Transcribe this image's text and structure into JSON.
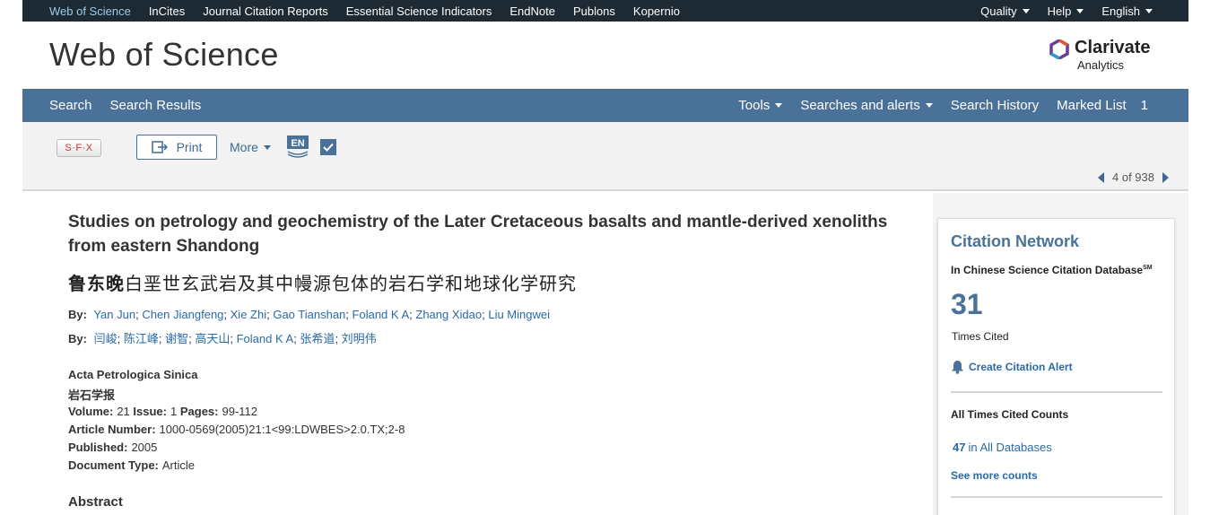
{
  "topbar": {
    "links": [
      "Web of Science",
      "InCites",
      "Journal Citation Reports",
      "Essential Science Indicators",
      "EndNote",
      "Publons",
      "Kopernio"
    ],
    "right": [
      "Quality",
      "Help",
      "English"
    ]
  },
  "brand": {
    "title": "Web of Science",
    "logo_word": "Clarivate",
    "logo_sub": "Analytics"
  },
  "nav": {
    "left": [
      "Search",
      "Search Results"
    ],
    "tools": "Tools",
    "alerts": "Searches and alerts",
    "history": "Search History",
    "marked": "Marked List",
    "marked_count": "1"
  },
  "toolbar": {
    "sfx": "S·F·X",
    "print": "Print",
    "more": "More",
    "en": "EN",
    "pager": "4 of 938"
  },
  "record": {
    "title": "Studies on petrology and geochemistry of the Later Cretaceous basalts and mantle-derived xenoliths from eastern Shandong",
    "title_cn_bold": "鲁东晚",
    "title_cn_rest": "白垩世玄武岩及其中幔源包体的岩石学和地球化学研究",
    "by_label": "By:",
    "authors": [
      "Yan Jun",
      "Chen Jiangfeng",
      "Xie Zhi",
      "Gao Tianshan",
      "Foland K A",
      "Zhang Xidao",
      "Liu Mingwei"
    ],
    "authors_cn": [
      "闫峻",
      "陈江峰",
      "谢智",
      "高天山",
      "Foland K A",
      "张希道",
      "刘明伟"
    ],
    "journal": "Acta Petrologica Sinica",
    "journal_cn": "岩石学报",
    "volume_label": "Volume:",
    "volume": "21",
    "issue_label": "Issue:",
    "issue": "1",
    "pages_label": "Pages:",
    "pages": "99-112",
    "article_number_label": "Article Number:",
    "article_number": "1000-0569(2005)21:1<99:LDWBES>2.0.TX;2-8",
    "published_label": "Published:",
    "published": "2005",
    "doctype_label": "Document Type:",
    "doctype": "Article",
    "abstract": "Abstract"
  },
  "citation_network": {
    "heading": "Citation Network",
    "database": "In Chinese Science Citation Database",
    "sm": "SM",
    "times_cited": "31",
    "times_cited_label": "Times Cited",
    "create_alert": "Create Citation Alert",
    "all_counts_heading": "All Times Cited Counts",
    "all_db_count": "47",
    "all_db_label": "in All Databases",
    "see_more": "See more counts"
  },
  "colors": {
    "topbar": "#1e2a33",
    "nav": "#4a7298",
    "link": "#2a6aa6",
    "accent": "#4a7298"
  }
}
